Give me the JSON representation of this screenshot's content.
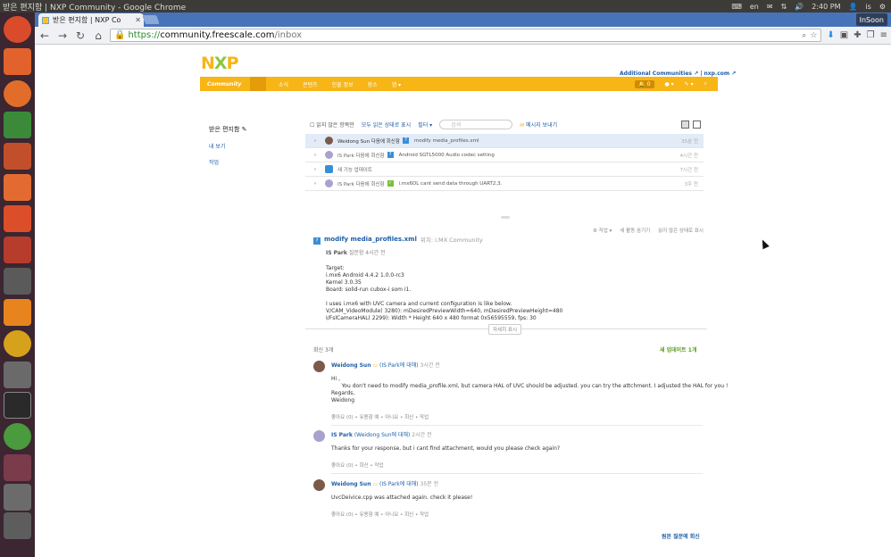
{
  "os": {
    "window_title": "받은 편지함 | NXP Community - Google Chrome",
    "lang": "en",
    "time": "2:40 PM",
    "user": "is"
  },
  "browser": {
    "tab_title": "받은 편지함 | NXP Co",
    "profile": "InSoon",
    "url_https": "https://",
    "url_host": "community.freescale.com",
    "url_path": "/inbox"
  },
  "site": {
    "logo_n": "N",
    "logo_x": "X",
    "logo_p": "P",
    "additional": "Additional Communities",
    "nxp": "nxp.com",
    "nav": [
      "Community",
      "소식",
      "콘텐츠",
      "인물 정보",
      "장소",
      "앱"
    ],
    "bell_count": "0"
  },
  "sidebar": {
    "heading": "받은 편지함",
    "links": [
      "내 보기",
      "작업"
    ]
  },
  "filters": {
    "unread": "읽지 않은 항목만",
    "mark_all": "모두 읽은 상태로 표시",
    "filter": "필터",
    "search_placeholder": "검색",
    "send": "메시지 보내기"
  },
  "inbox": [
    {
      "who": "Weidong Sun 다음에 회신함",
      "subject": "modify media_profiles.xml",
      "time": "35분 전"
    },
    {
      "who": "IS Park 다음에 회신함",
      "subject": "Android SGTL5000 Audio codec setting",
      "time": "4시간 전"
    },
    {
      "who": "새 기능 업데이트",
      "subject": "",
      "time": "7시간 전"
    },
    {
      "who": "IS Park 다음에 회신함",
      "subject": "i.mx6DL cant send data through UART2,3.",
      "time": "3주 전"
    }
  ],
  "detail": {
    "actions": [
      "작업",
      "새 활동 숨기기",
      "읽지 않은 상태로 표시"
    ],
    "title": "modify media_profiles.xml",
    "location": "위치: i.MX Community",
    "asker": "IS Park",
    "asked": "질문함 4시간 전",
    "body": "Target:\ni.mx6 Android 4.4.2 1.0.0-rc3\nKernel 3.0.35\nBoard: solid-run cubox-i som i1.\n\nI uses i.mx6 with UVC camera and current configuration is like below.\nV/CAM_VideoModule( 3280): mDesiredPreviewWidth=640, mDesiredPreviewHeight=480\nI/FslCameraHAL( 2299): Width * Height 640 x 480 format 0x56595559, fps: 30\n\nNow I wanna change resolution to below.",
    "more": "자세히 표시",
    "replies_count": "회신 3개",
    "new_updates": "새 업데이트 1개",
    "reply_original": "원본 질문에 회신"
  },
  "replies": [
    {
      "author": "Weidong Sun",
      "to": "(IS Park에 대해)",
      "time": "3시간 전",
      "text": "Hi ,\n      You don't need to modify media_profile.xml, but camera HAL of UVC should be adjusted. you can try the attchment. I adjusted the HAL for you !\nRegards,\nWeidong",
      "actions": "좋아요 (0)  •  유용함 예  •  아니요  •  회신  •  작업"
    },
    {
      "author": "IS Park",
      "to": "(Weidong Sun에 대해)",
      "time": "2시간 전",
      "text": "Thanks for your response, but i cant find attachment, would you please check again?",
      "actions": "좋아요 (0)  •  회신  •  작업"
    },
    {
      "author": "Weidong Sun",
      "to": "(IS Park에 대해)",
      "time": "35분 전",
      "text": "UvcDeivice.cpp was attached again. check it please!",
      "actions": "좋아요 (0)  •  유용함 예  •  아니요  •  회신  •  작업"
    }
  ],
  "colors": {
    "nxp_orange": "#f7b516",
    "link_blue": "#1e5ea8",
    "launcher": "#3b2631"
  }
}
